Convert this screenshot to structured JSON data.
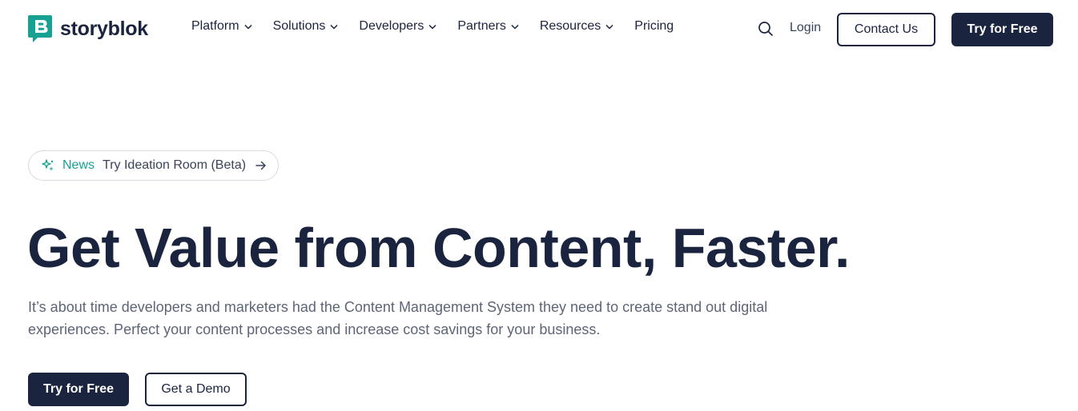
{
  "brand": {
    "name": "storyblok",
    "logo_icon": "storyblok-logo-icon",
    "accent_color": "#17a192",
    "dark_color": "#1b243f"
  },
  "nav": {
    "items": [
      {
        "label": "Platform",
        "has_dropdown": true
      },
      {
        "label": "Solutions",
        "has_dropdown": true
      },
      {
        "label": "Developers",
        "has_dropdown": true
      },
      {
        "label": "Partners",
        "has_dropdown": true
      },
      {
        "label": "Resources",
        "has_dropdown": true
      },
      {
        "label": "Pricing",
        "has_dropdown": false
      }
    ],
    "search_icon": "search-icon",
    "login_label": "Login",
    "contact_label": "Contact Us",
    "try_label": "Try for Free"
  },
  "hero": {
    "news": {
      "icon": "sparkle-icon",
      "tag": "News",
      "text": "Try Ideation Room (Beta)",
      "arrow_icon": "arrow-right-icon"
    },
    "headline": "Get Value from Content, Faster.",
    "subtext": "It’s about time developers and marketers had the Content Management System they need to create stand out digital experiences. Perfect your content processes and increase cost savings for your business.",
    "primary_cta": "Try for Free",
    "secondary_cta": "Get a Demo"
  }
}
